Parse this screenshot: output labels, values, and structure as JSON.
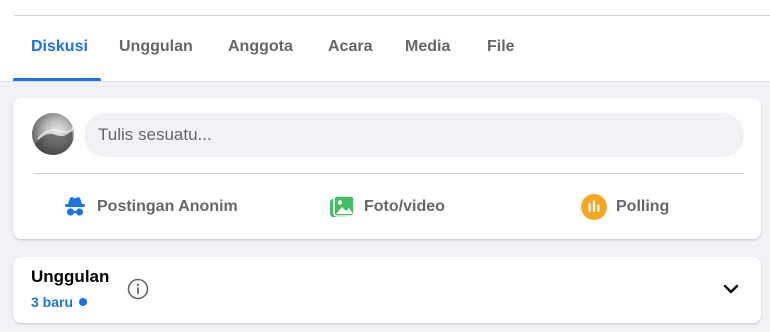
{
  "tabs": [
    {
      "label": "Diskusi",
      "active": true
    },
    {
      "label": "Unggulan",
      "active": false
    },
    {
      "label": "Anggota",
      "active": false
    },
    {
      "label": "Acara",
      "active": false
    },
    {
      "label": "Media",
      "active": false
    },
    {
      "label": "File",
      "active": false
    }
  ],
  "composer": {
    "placeholder": "Tulis sesuatu...",
    "actions": [
      {
        "label": "Postingan Anonim",
        "icon": "anonymous-icon",
        "color": "#1b74e4"
      },
      {
        "label": "Foto/video",
        "icon": "photo-video-icon",
        "color": "#45bd62"
      },
      {
        "label": "Polling",
        "icon": "poll-icon",
        "color": "#f7b928"
      }
    ]
  },
  "featured": {
    "title": "Unggulan",
    "new_count": "3 baru"
  },
  "colors": {
    "accent": "#1b74e4",
    "background": "#f0f2f5",
    "text_secondary": "#65676b"
  }
}
